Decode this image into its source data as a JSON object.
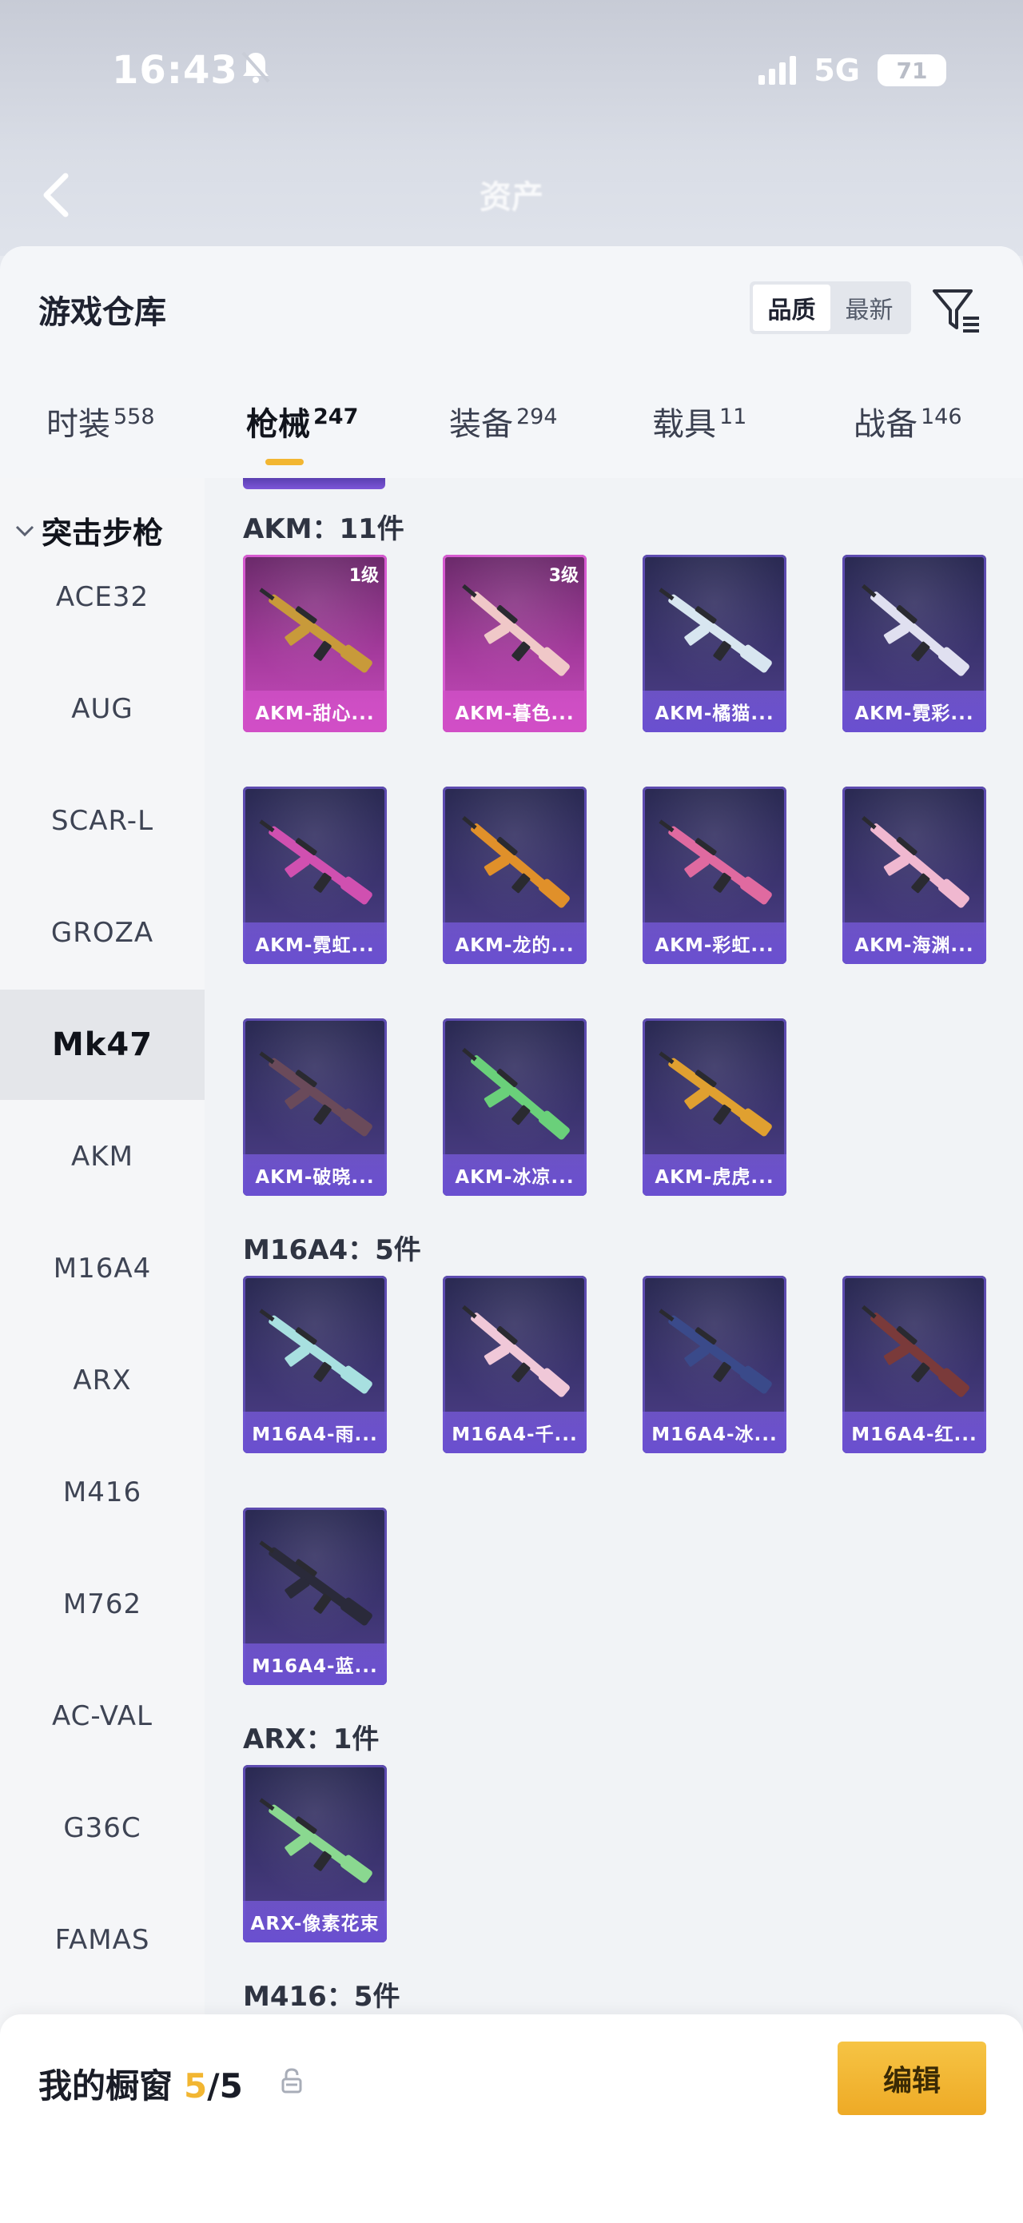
{
  "status_bar": {
    "time": "16:43",
    "network": "5G",
    "battery": "71"
  },
  "background_header": {
    "title": "资产"
  },
  "warehouse": {
    "title": "游戏仓库",
    "sort_options": [
      "品质",
      "最新"
    ],
    "active_sort": "品质",
    "tabs": [
      {
        "label": "时装",
        "count": "558"
      },
      {
        "label": "枪械",
        "count": "247"
      },
      {
        "label": "装备",
        "count": "294"
      },
      {
        "label": "载具",
        "count": "11"
      },
      {
        "label": "战备",
        "count": "146"
      }
    ],
    "active_tab": "枪械"
  },
  "rail": {
    "group": "突击步枪",
    "items": [
      "ACE32",
      "AUG",
      "SCAR-L",
      "GROZA",
      "Mk47",
      "AKM",
      "M16A4",
      "ARX",
      "M416",
      "M762",
      "AC-VAL",
      "G36C",
      "FAMAS"
    ],
    "active": "Mk47"
  },
  "sections": [
    {
      "title": "AKM：11件",
      "items": [
        {
          "name": "AKM-甜心...",
          "level": "1级",
          "rarity": "pink",
          "color": "#c89a3a"
        },
        {
          "name": "AKM-暮色...",
          "level": "3级",
          "rarity": "pink",
          "color": "#f0c8c8"
        },
        {
          "name": "AKM-橘猫...",
          "level": "",
          "rarity": "purple",
          "color": "#d8e6f0"
        },
        {
          "name": "AKM-霓彩...",
          "level": "",
          "rarity": "purple",
          "color": "#e0e0f0"
        },
        {
          "name": "AKM-霓虹...",
          "level": "",
          "rarity": "purple",
          "color": "#d050b0"
        },
        {
          "name": "AKM-龙的...",
          "level": "",
          "rarity": "purple",
          "color": "#e0902a"
        },
        {
          "name": "AKM-彩虹...",
          "level": "",
          "rarity": "purple",
          "color": "#e06aa0"
        },
        {
          "name": "AKM-海渊...",
          "level": "",
          "rarity": "purple",
          "color": "#f0b8d0"
        },
        {
          "name": "AKM-破晓...",
          "level": "",
          "rarity": "purple",
          "color": "#6a4a5a"
        },
        {
          "name": "AKM-冰凉...",
          "level": "",
          "rarity": "purple",
          "color": "#6ad07a"
        },
        {
          "name": "AKM-虎虎...",
          "level": "",
          "rarity": "purple",
          "color": "#e0a030"
        }
      ]
    },
    {
      "title": "M16A4：5件",
      "items": [
        {
          "name": "M16A4-雨...",
          "level": "",
          "rarity": "purple",
          "color": "#a8e0e0"
        },
        {
          "name": "M16A4-千...",
          "level": "",
          "rarity": "purple",
          "color": "#f0c8d8"
        },
        {
          "name": "M16A4-冰...",
          "level": "",
          "rarity": "purple",
          "color": "#3a4a8a"
        },
        {
          "name": "M16A4-红...",
          "level": "",
          "rarity": "purple",
          "color": "#7a3a3a"
        },
        {
          "name": "M16A4-蓝...",
          "level": "",
          "rarity": "purple",
          "color": "#2a2a3a"
        }
      ]
    },
    {
      "title": "ARX：1件",
      "items": [
        {
          "name": "ARX-像素花束",
          "level": "",
          "rarity": "purple",
          "color": "#8ad890"
        }
      ]
    },
    {
      "title": "M416：5件",
      "items": []
    }
  ],
  "bottom_bar": {
    "title": "我的橱窗",
    "current": "5",
    "total": "/5",
    "edit_label": "编辑"
  },
  "colors": {
    "accent": "#f2b632",
    "purple_card": "#3c3470",
    "pink_card": "#a43a9c"
  },
  "icons": {
    "filter": "filter-icon",
    "share": "share-icon",
    "lock": "lock-icon",
    "back": "back-arrow-icon",
    "chevron": "chevron-down-icon"
  }
}
